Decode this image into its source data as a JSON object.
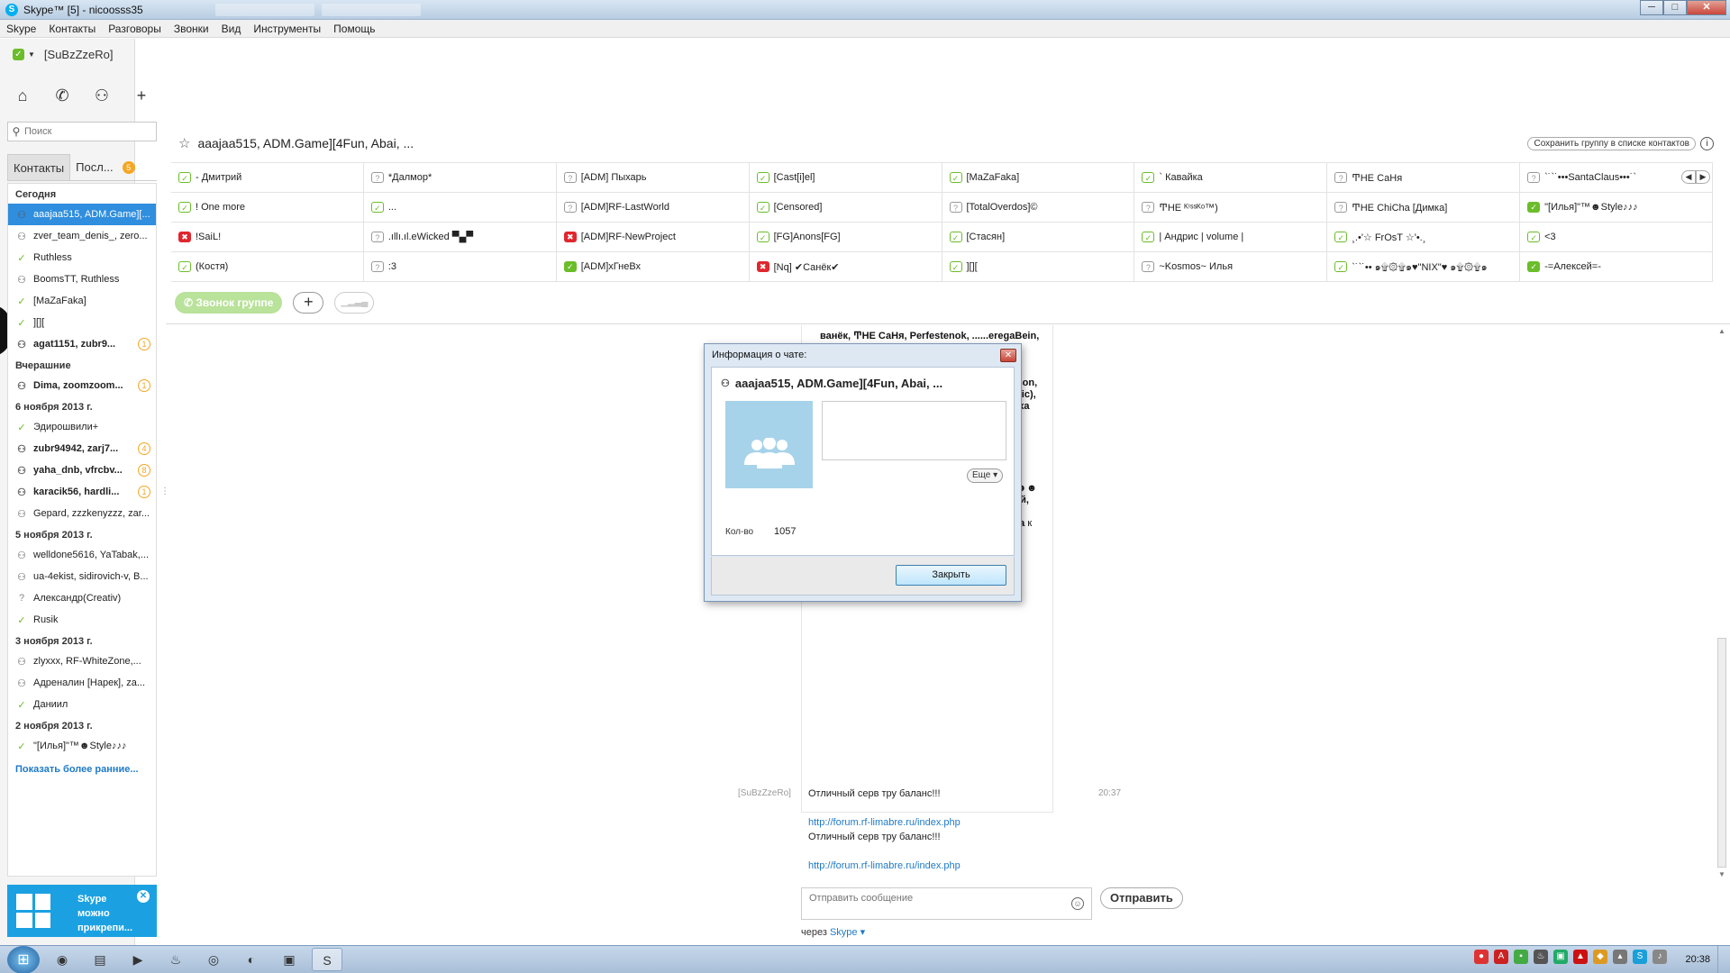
{
  "window": {
    "title": "Skype™ [5] - nicoosss35",
    "controls": [
      "─",
      "□",
      "✕"
    ]
  },
  "menu": [
    "Skype",
    "Контакты",
    "Разговоры",
    "Звонки",
    "Вид",
    "Инструменты",
    "Помощь"
  ],
  "profile": {
    "name": "[SuBzZzeRo]",
    "status": "online"
  },
  "search": {
    "placeholder": "Поиск"
  },
  "tabs": {
    "contacts": "Контакты",
    "recent": "Посл...",
    "recent_badge": "5"
  },
  "contact_list": {
    "groups": [
      {
        "label": "Сегодня",
        "items": [
          {
            "name": "aaajaa515, ADM.Game][...",
            "icon": "group",
            "selected": true,
            "bold": false,
            "badge": ""
          },
          {
            "name": "zver_team_denis_, zero...",
            "icon": "group",
            "selected": false,
            "bold": false,
            "badge": ""
          },
          {
            "name": "Ruthless",
            "icon": "status-online",
            "selected": false,
            "bold": false,
            "badge": ""
          },
          {
            "name": "BoomsTT, Ruthless",
            "icon": "group",
            "selected": false,
            "bold": false,
            "badge": ""
          },
          {
            "name": "[MaZaFaka]",
            "icon": "status-online",
            "selected": false,
            "bold": false,
            "badge": ""
          },
          {
            "name": "][][",
            "icon": "status-online",
            "selected": false,
            "bold": false,
            "badge": ""
          },
          {
            "name": "agat1151, zubr9...",
            "icon": "group",
            "selected": false,
            "bold": true,
            "badge": "1"
          }
        ]
      },
      {
        "label": "Вчерашние",
        "items": [
          {
            "name": "Dima, zoomzoom...",
            "icon": "group",
            "selected": false,
            "bold": true,
            "badge": "1"
          }
        ]
      },
      {
        "label": "6 ноября 2013 г.",
        "items": [
          {
            "name": "Эдирошвили+",
            "icon": "status-online",
            "selected": false,
            "bold": false,
            "badge": ""
          },
          {
            "name": "zubr94942, zarj7...",
            "icon": "group",
            "selected": false,
            "bold": true,
            "badge": "4"
          },
          {
            "name": "yaha_dnb, vfrcbv...",
            "icon": "group",
            "selected": false,
            "bold": true,
            "badge": "8"
          },
          {
            "name": "karacik56, hardli...",
            "icon": "group",
            "selected": false,
            "bold": true,
            "badge": "1"
          },
          {
            "name": "Gepard, zzzkenyzzz, zar...",
            "icon": "group",
            "selected": false,
            "bold": false,
            "badge": ""
          }
        ]
      },
      {
        "label": "5 ноября 2013 г.",
        "items": [
          {
            "name": "welldone5616, YaTabak,...",
            "icon": "group",
            "selected": false,
            "bold": false,
            "badge": ""
          },
          {
            "name": "ua-4ekist, sidirovich-v, B...",
            "icon": "group",
            "selected": false,
            "bold": false,
            "badge": ""
          },
          {
            "name": "Александр(Creativ)",
            "icon": "status-unknown",
            "selected": false,
            "bold": false,
            "badge": ""
          },
          {
            "name": "Rusik",
            "icon": "status-online",
            "selected": false,
            "bold": false,
            "badge": ""
          }
        ]
      },
      {
        "label": "3 ноября 2013 г.",
        "items": [
          {
            "name": "zlyxxx, RF-WhiteZone,...",
            "icon": "group",
            "selected": false,
            "bold": false,
            "badge": ""
          },
          {
            "name": "Адреналин [Нарек], za...",
            "icon": "group",
            "selected": false,
            "bold": false,
            "badge": ""
          },
          {
            "name": "Даниил",
            "icon": "status-online",
            "selected": false,
            "bold": false,
            "badge": ""
          }
        ]
      },
      {
        "label": "2 ноября 2013 г.",
        "items": [
          {
            "name": "\"[Илья]\"™☻Style♪♪♪",
            "icon": "status-online",
            "selected": false,
            "bold": false,
            "badge": ""
          }
        ]
      }
    ],
    "show_more": "Показать более ранние..."
  },
  "promo": {
    "text_line1": "Skype",
    "text_line2": "можно",
    "text_line3": "прикрепи..."
  },
  "conversation": {
    "title": "aaajaa515, ADM.Game][4Fun, Abai, ...",
    "save_group": "Сохранить группу в списке контактов",
    "call_group": "Звонок группе",
    "participants": [
      {
        "name": "- Дмитрий",
        "status": "online-outline"
      },
      {
        "name": "*Далмор*",
        "status": "unknown"
      },
      {
        "name": "[ADM] Пыхарь",
        "status": "unknown"
      },
      {
        "name": "[Cast[i]el]",
        "status": "online-outline"
      },
      {
        "name": "[MaZaFaka]",
        "status": "online-outline"
      },
      {
        "name": "` Кавайка",
        "status": "online-outline"
      },
      {
        "name": "ͲΗΕ СаНя",
        "status": "unknown"
      },
      {
        "name": "`˙`˙•••SantaClaus•••˙`",
        "status": "unknown"
      },
      {
        "name": "! One more",
        "status": "online-outline"
      },
      {
        "name": "...",
        "status": "online-outline"
      },
      {
        "name": "[ADM]RF-LastWorld",
        "status": "unknown"
      },
      {
        "name": "[Censored]",
        "status": "online-outline"
      },
      {
        "name": "[TotalOverdos]©",
        "status": "unknown"
      },
      {
        "name": "ͲΗΕ ᴷⁱˢˢᴷᵒ™)",
        "status": "unknown"
      },
      {
        "name": "ͲΗΕ ChiCha [Димка]",
        "status": "unknown"
      },
      {
        "name": "\"[Илья]\"™☻Style♪♪♪",
        "status": "online"
      },
      {
        "name": "!SaiL!",
        "status": "busy"
      },
      {
        "name": ".ıllı.ıl.eWicked ▀▄▀",
        "status": "unknown"
      },
      {
        "name": "[ADM]RF-NewProject",
        "status": "busy"
      },
      {
        "name": "[FG]Anons[FG]",
        "status": "online-outline"
      },
      {
        "name": "[Стасян]",
        "status": "online-outline"
      },
      {
        "name": "| Андрис | volume |",
        "status": "online-outline"
      },
      {
        "name": "¸.•'☆ FrOsT ☆'•.¸",
        "status": "online-outline"
      },
      {
        "name": "<3",
        "status": "online-outline"
      },
      {
        "name": "(Костя)",
        "status": "online-outline"
      },
      {
        "name": ":3",
        "status": "unknown"
      },
      {
        "name": "[ADM]хГнеВх",
        "status": "online"
      },
      {
        "name": "[Nq] ✔Санёк✔",
        "status": "busy"
      },
      {
        "name": "][][",
        "status": "online-outline"
      },
      {
        "name": "~Kosmos~ Илья",
        "status": "unknown"
      },
      {
        "name": "`˙`˙•• ๑۩۞۩๑♥\"NIX\"♥ ๑۩۞۩๑",
        "status": "online-outline"
      },
      {
        "name": "-=Алексей=-",
        "status": "online"
      }
    ]
  },
  "chat": {
    "join_notice_bold": "ванёк, ͲΗΕ СаНя, Perfestenok, ......eregaBein, ......rdos]©, ......PvP, ......s, ultimo, ......ис ......лина, Женя ......], Rusik, ......ндр ......)), СаНя ......андр, ......| [Khan], ......Манагер, ......ΗΕ ......s, ......Камалов, TheSir, Headdyson, ok, Иван, Smail, Никита Трофимов, G'M(pic), жека(мвд), tures, ꧁[K]aIIpu[3], Rassomaxa xxx, Norm, вадошка, Валентин, YaTabak, Иван Версоцкий, Виктор, Виталя Фамин, Виктор, KaPnoB, vovandryk, Volodiu\", Андрей(Бус), SkyLine, ꧁LoSTiK#[3Dfx], Vriska(Hidan), windows][ Даня, Gre[M]liN_a.k.a_iPsy, Ирина Халяпина, Sane`k, Андрей(MovikDrive), Yankovsky, ☻☻☻™Ярик™☻☻☻ , Димка=*, Ваня Мафтей, !SaiL!, Дэвид Блейн, Дмитрий, zarj785, ПростоЧёрный, Адреналин [Нарек], Дима",
    "join_notice_tail": " к этому чату",
    "sender": "[SuBzZzeRo]",
    "message1": "Отличный серв тру баланс!!!",
    "time": "20:37",
    "link1": "http://forum.rf-limabre.ru/index.php",
    "message2": "Отличный серв тру баланс!!!",
    "link2": "http://forum.rf-limabre.ru/index.php",
    "input_placeholder": "Отправить сообщение",
    "send": "Отправить",
    "via_prefix": "через",
    "via_service": "Skype"
  },
  "dialog": {
    "title": "Информация о чате:",
    "chat_name": "aaajaa515, ADM.Game][4Fun, Abai, ...",
    "more": "Еще",
    "count_label": "Кол-во",
    "count_value": "1057",
    "close": "Закрыть"
  },
  "taskbar": {
    "clock": "20:38"
  },
  "colors": {
    "skype_blue": "#00aff0",
    "online": "#6bbd2a",
    "busy": "#e0262e",
    "selection": "#2f8ede",
    "promo": "#1ba1e2"
  }
}
